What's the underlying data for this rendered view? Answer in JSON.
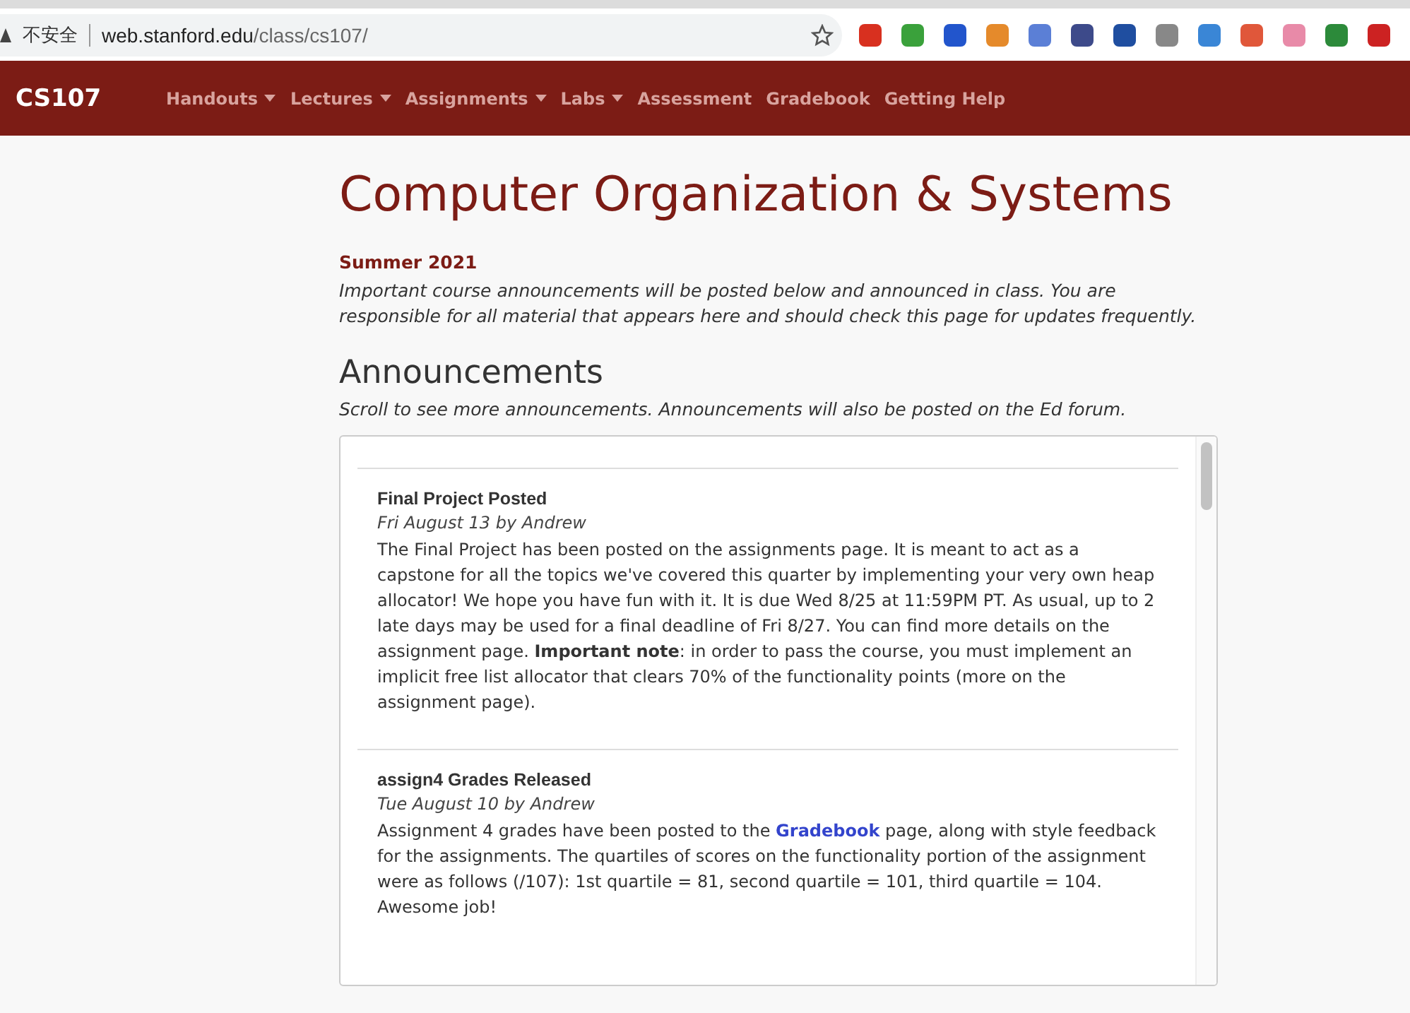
{
  "browser": {
    "security": "不安全",
    "url_host": "web.stanford.edu",
    "url_path": "/class/cs107/"
  },
  "navbar": {
    "brand": "CS107",
    "items": [
      {
        "label": "Handouts",
        "dropdown": true
      },
      {
        "label": "Lectures",
        "dropdown": true
      },
      {
        "label": "Assignments",
        "dropdown": true
      },
      {
        "label": "Labs",
        "dropdown": true
      },
      {
        "label": "Assessment",
        "dropdown": false
      },
      {
        "label": "Gradebook",
        "dropdown": false
      },
      {
        "label": "Getting Help",
        "dropdown": false
      }
    ]
  },
  "page": {
    "title": "Computer Organization & Systems",
    "term": "Summer 2021",
    "intro": "Important course announcements will be posted below and announced in class. You are responsible for all material that appears here and should check this page for updates frequently.",
    "announcements_heading": "Announcements",
    "announcements_note": "Scroll to see more announcements. Announcements will also be posted on the Ed forum."
  },
  "announcements": [
    {
      "title": "Final Project Posted",
      "meta": "Fri August 13 by Andrew",
      "body": [
        {
          "kind": "text",
          "text": "The Final Project has been posted on the assignments page. It is meant to act as a capstone for all the topics we've covered this quarter by implementing your very own heap allocator! We hope you have fun with it. It is due Wed 8/25 at 11:59PM PT. As usual, up to 2 late days may be used for a final deadline of Fri 8/27. You can find more details on the assignment page. **Important note**: in order to pass the course, you must implement an implicit free list allocator that clears 70% of the functionality points (more on the assignment page)."
        }
      ]
    },
    {
      "title": "assign4 Grades Released",
      "meta": "Tue August 10 by Andrew",
      "body": [
        {
          "kind": "text",
          "text": "Assignment 4 grades have been posted to the "
        },
        {
          "kind": "link",
          "text": "Gradebook"
        },
        {
          "kind": "text",
          "text": " page, along with style feedback for the assignments. The quartiles of scores on the functionality portion of the assignment were as follows (/107): 1st quartile = 81, second quartile = 101, third quartile = 104. Awesome job!"
        }
      ]
    }
  ]
}
